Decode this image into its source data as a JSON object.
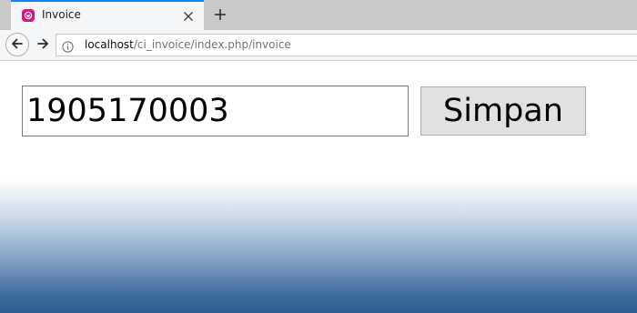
{
  "browser": {
    "tab": {
      "title": "Invoice",
      "favicon_color": "#e0117a"
    },
    "accent_color": "#0a84ff",
    "address_bar": {
      "host": "localhost",
      "path": "/ci_invoice/index.php/invoice"
    },
    "icons": {
      "favicon": "tab-favicon-icon",
      "close_tab": "close-icon",
      "new_tab": "plus-icon",
      "back": "arrow-left-icon",
      "forward": "arrow-right-icon",
      "site_info": "info-icon"
    }
  },
  "form": {
    "invoice_number_value": "1905170003",
    "save_label": "Simpan"
  },
  "page_colors": {
    "background_top": "#ffffff",
    "background_bottom": "#2f5f94"
  }
}
